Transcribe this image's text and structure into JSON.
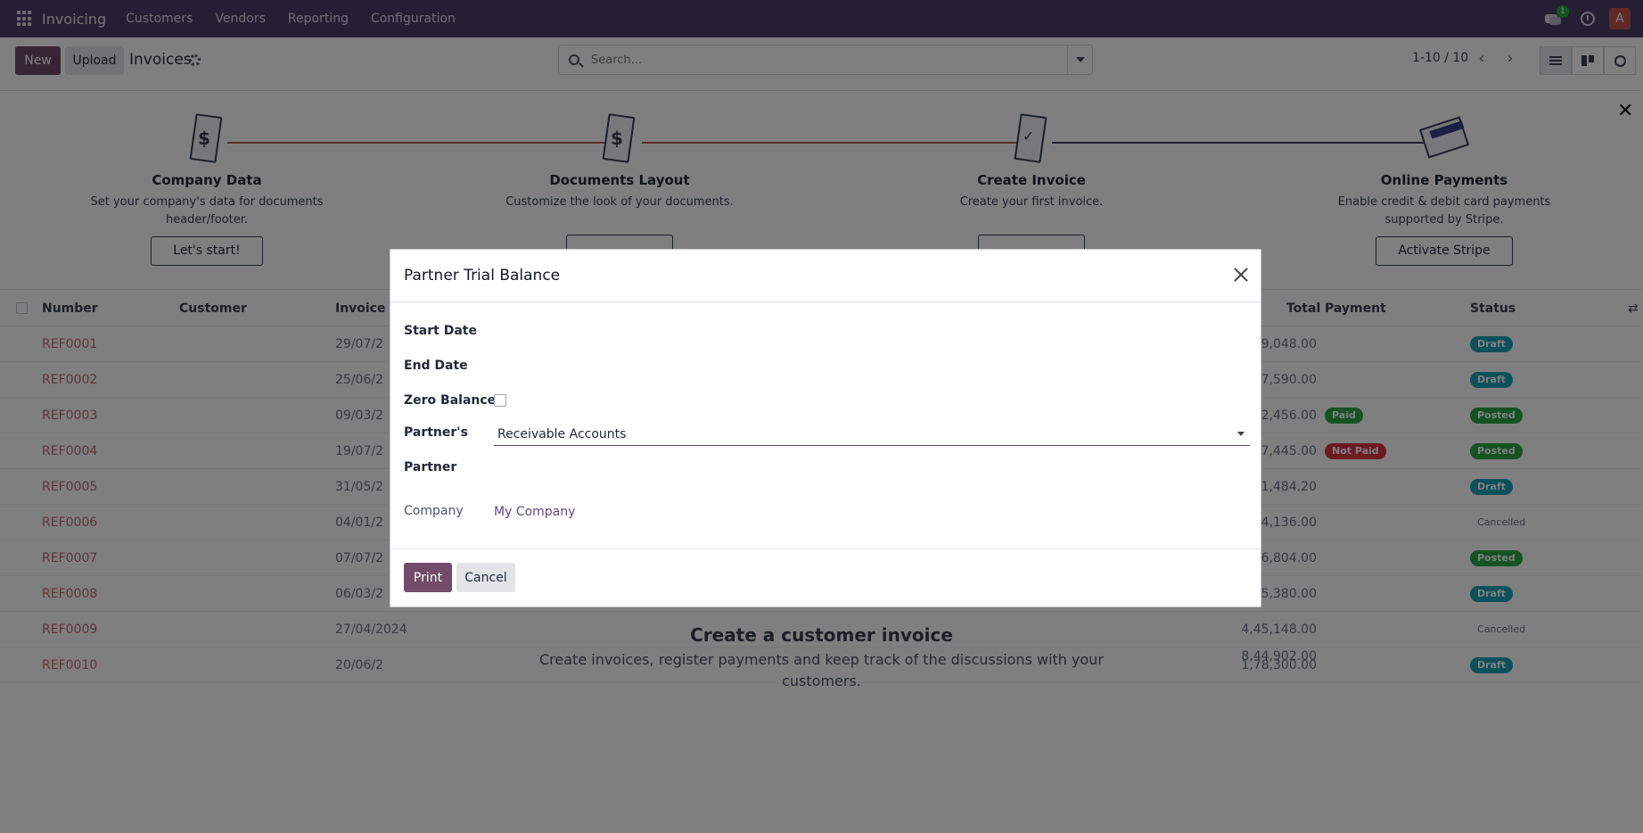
{
  "navbar": {
    "brand": "Invoicing",
    "menu": [
      "Customers",
      "Vendors",
      "Reporting",
      "Configuration"
    ],
    "chat_count": "1",
    "avatar_letter": "A"
  },
  "control": {
    "new_label": "New",
    "upload_label": "Upload",
    "title": "Invoices",
    "search_placeholder": "Search...",
    "pager": "1-10 / 10"
  },
  "onboarding": {
    "steps": [
      {
        "title": "Company Data",
        "desc": "Set your company's data for documents header/footer.",
        "button": "Let's start!"
      },
      {
        "title": "Documents Layout",
        "desc": "Customize the look of your documents.",
        "button": ""
      },
      {
        "title": "Create Invoice",
        "desc": "Create your first invoice.",
        "button": ""
      },
      {
        "title": "Online Payments",
        "desc": "Enable credit & debit card payments supported by Stripe.",
        "button": "Activate Stripe"
      }
    ]
  },
  "list": {
    "headers": [
      "Number",
      "Customer",
      "Invoice D",
      "Total",
      "Payment",
      "Status"
    ],
    "rows": [
      {
        "number": "REF0001",
        "date": "29/07/2",
        "total": "9,048.00",
        "payment": "",
        "status": "Draft"
      },
      {
        "number": "REF0002",
        "date": "25/06/2",
        "total": "7,590.00",
        "payment": "",
        "status": "Draft"
      },
      {
        "number": "REF0003",
        "date": "09/03/2",
        "total": "2,456.00",
        "payment": "Paid",
        "status": "Posted"
      },
      {
        "number": "REF0004",
        "date": "19/07/2",
        "total": "7,445.00",
        "payment": "Not Paid",
        "status": "Posted"
      },
      {
        "number": "REF0005",
        "date": "31/05/2",
        "total": "1,484.20",
        "payment": "",
        "status": "Draft"
      },
      {
        "number": "REF0006",
        "date": "04/01/2",
        "total": "4,136.00",
        "payment": "",
        "status": "Cancelled"
      },
      {
        "number": "REF0007",
        "date": "07/07/2",
        "total": "6,804.00",
        "payment": "",
        "status": "Posted"
      },
      {
        "number": "REF0008",
        "date": "06/03/2",
        "total": "5,380.00",
        "payment": "",
        "status": "Draft"
      },
      {
        "number": "REF0009",
        "date": "27/04/2024",
        "total": "4,45,148.00",
        "payment": "",
        "status": "Cancelled"
      },
      {
        "number": "REF0010",
        "date": "20/06/2",
        "total": "1,78,300.00",
        "payment": "",
        "status": "Draft"
      }
    ],
    "footer_total": "8,44,902.00"
  },
  "help": {
    "heading": "Create a customer invoice",
    "text_line1": "Create invoices, register payments and keep track of the discussions with your",
    "text_line2": "customers."
  },
  "modal": {
    "title": "Partner Trial Balance",
    "start_date_label": "Start Date",
    "end_date_label": "End Date",
    "zero_balance_label": "Zero Balance",
    "zero_balance_checked": false,
    "partners_label": "Partner's",
    "partners_value": "Receivable Accounts",
    "partner_label": "Partner",
    "company_label": "Company",
    "company_value": "My Company",
    "print_label": "Print",
    "cancel_label": "Cancel"
  },
  "colors": {
    "navbar": "#4b3f66",
    "primary": "#714b67",
    "link": "#5b4a8a"
  }
}
